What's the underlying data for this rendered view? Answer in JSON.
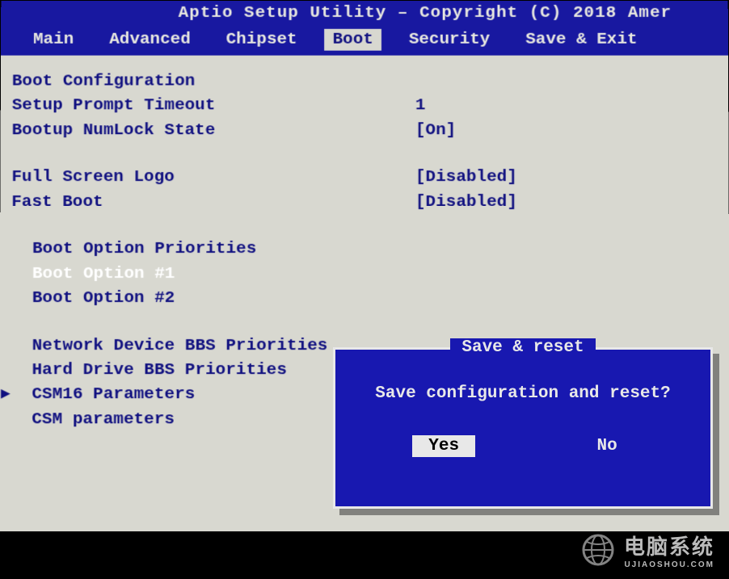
{
  "header": {
    "title": "Aptio Setup Utility – Copyright (C) 2018 Amer"
  },
  "tabs": [
    {
      "label": "Main",
      "active": false
    },
    {
      "label": "Advanced",
      "active": false
    },
    {
      "label": "Chipset",
      "active": false
    },
    {
      "label": "Boot",
      "active": true
    },
    {
      "label": "Security",
      "active": false
    },
    {
      "label": "Save & Exit",
      "active": false
    }
  ],
  "boot": {
    "section_config": "Boot Configuration",
    "prompt_timeout": {
      "label": "Setup Prompt Timeout",
      "value": "1"
    },
    "numlock": {
      "label": "Bootup NumLock State",
      "value": "[On]"
    },
    "full_screen_logo": {
      "label": "Full Screen Logo",
      "value": "[Disabled]"
    },
    "fast_boot": {
      "label": "Fast Boot",
      "value": "[Disabled]"
    },
    "section_priorities": "Boot Option Priorities",
    "option1": {
      "label": "Boot Option #1"
    },
    "option2": {
      "label": "Boot Option #2"
    },
    "net_bbs": "Network Device BBS Priorities",
    "hdd_bbs": "Hard Drive BBS Priorities",
    "csm16": "CSM16 Parameters",
    "csm": "CSM parameters"
  },
  "dialog": {
    "title": "Save & reset",
    "message": "Save configuration and reset?",
    "yes": "Yes",
    "no": "No"
  },
  "watermark": {
    "brand": "电脑系统",
    "url": "UJIAOSHOU.COM"
  }
}
